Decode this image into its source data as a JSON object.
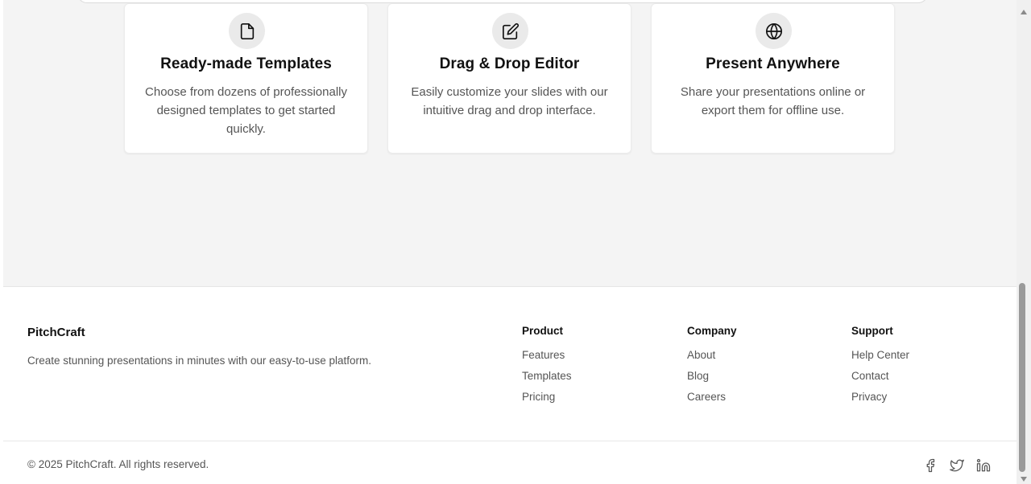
{
  "features": [
    {
      "icon": "file-icon",
      "title": "Ready-made Templates",
      "description": "Choose from dozens of professionally designed templates to get started quickly."
    },
    {
      "icon": "edit-icon",
      "title": "Drag & Drop Editor",
      "description": "Easily customize your slides with our intuitive drag and drop interface."
    },
    {
      "icon": "globe-icon",
      "title": "Present Anywhere",
      "description": "Share your presentations online or export them for offline use."
    }
  ],
  "footer": {
    "brand": "PitchCraft",
    "tagline": "Create stunning presentations in minutes with our easy-to-use platform.",
    "columns": [
      {
        "title": "Product",
        "links": [
          "Features",
          "Templates",
          "Pricing"
        ]
      },
      {
        "title": "Company",
        "links": [
          "About",
          "Blog",
          "Careers"
        ]
      },
      {
        "title": "Support",
        "links": [
          "Help Center",
          "Contact",
          "Privacy"
        ]
      }
    ],
    "copyright": "© 2025 PitchCraft. All rights reserved.",
    "social": [
      "facebook-icon",
      "twitter-icon",
      "linkedin-icon"
    ]
  },
  "colors": {
    "section_bg": "#f4f4f4",
    "card_bg": "#ffffff",
    "icon_circle_bg": "#eaeaea",
    "heading": "#111111",
    "body_text": "#555555"
  }
}
